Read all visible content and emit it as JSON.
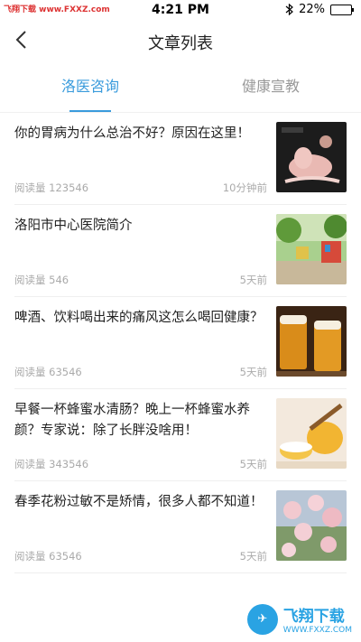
{
  "status_bar": {
    "watermark": "飞翔下载 www.FXXZ.com",
    "time": "4:21 PM",
    "battery": "22%",
    "battery_level": 0.22
  },
  "nav": {
    "title": "文章列表"
  },
  "tabs": [
    {
      "label": "洛医咨询",
      "active": true
    },
    {
      "label": "健康宣教",
      "active": false
    }
  ],
  "articles": [
    {
      "title": "你的胃病为什么总治不好？原因在这里！",
      "reads": "阅读量 123546",
      "time": "10分钟前",
      "image": "stomach-illustration"
    },
    {
      "title": "洛阳市中心医院简介",
      "reads": "阅读量 546",
      "time": "5天前",
      "image": "playground-photo"
    },
    {
      "title": "啤酒、饮料喝出来的痛风这怎么喝回健康？",
      "reads": "阅读量 63546",
      "time": "5天前",
      "image": "beer-glasses-photo"
    },
    {
      "title": "早餐一杯蜂蜜水清肠？晚上一杯蜂蜜水养颜？专家说：除了长胖没啥用！",
      "reads": "阅读量 343546",
      "time": "5天前",
      "image": "honey-photo"
    },
    {
      "title": "春季花粉过敏不是矫情，很多人都不知道！",
      "reads": "阅读量 63546",
      "time": "5天前",
      "image": "flowers-photo"
    }
  ],
  "footer_logo": {
    "cn": "飞翔下载",
    "en": "WWW.FXXZ.COM"
  }
}
